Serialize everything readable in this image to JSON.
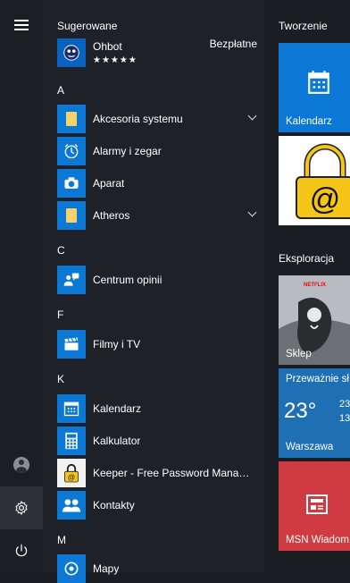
{
  "suggested": {
    "header": "Sugerowane",
    "app": "Ohbot",
    "stars": "★★★★★",
    "badge": "Bezpłatne"
  },
  "sections": {
    "a": "A",
    "c": "C",
    "f": "F",
    "k": "K",
    "m": "M"
  },
  "apps": {
    "akcesoria": "Akcesoria systemu",
    "alarmy": "Alarmy i zegar",
    "aparat": "Aparat",
    "atheros": "Atheros",
    "centrum": "Centrum opinii",
    "filmy": "Filmy i TV",
    "kalendarz": "Kalendarz",
    "kalkulator": "Kalkulator",
    "keeper": "Keeper - Free Password Manager...",
    "kontakty": "Kontakty",
    "mapy": "Mapy"
  },
  "tiles": {
    "group1": "Tworzenie",
    "calendar": "Kalendarz",
    "group2": "Eksploracja",
    "store": "Sklep",
    "store_brand": "NETFLIX",
    "weather_top": "Przeważnie sł...",
    "weather_temp": "23°",
    "weather_hi": "23",
    "weather_lo": "13",
    "weather_city": "Warszawa",
    "msn": "MSN Wiadom..."
  },
  "colors": {
    "accent": "#0a78d4",
    "folder": "#f7d26a",
    "msn": "#cf3b40",
    "weather": "#1f6fb5"
  },
  "icons": {
    "hamburger": "hamburger-icon",
    "user": "user-icon",
    "settings": "gear-icon",
    "power": "power-icon"
  }
}
